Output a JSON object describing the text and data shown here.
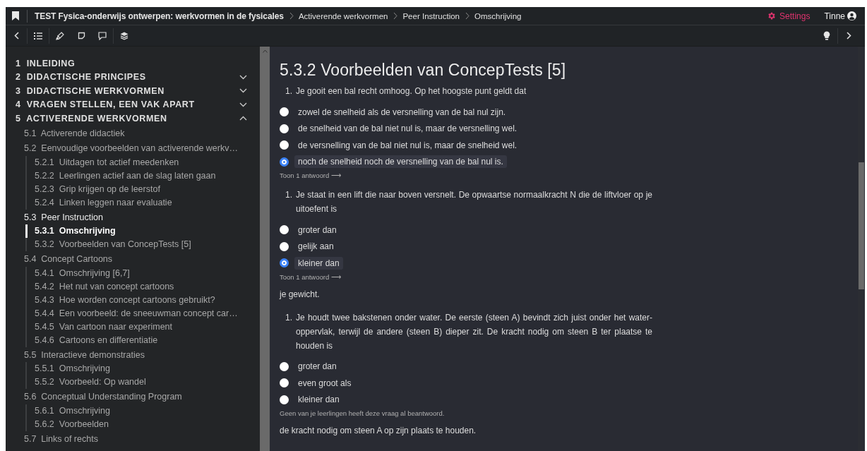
{
  "header": {
    "book_title": "TEST Fysica-onderwijs ontwerpen: werkvormen in de fysicales",
    "breadcrumbs": [
      "Activerende werkvormen",
      "Peer Instruction",
      "Omschrijving"
    ],
    "settings": "Settings",
    "user": "Tinne"
  },
  "sidebar": {
    "chapters": [
      {
        "number": "1",
        "title": "INLEIDING",
        "kind": "leaf"
      },
      {
        "number": "2",
        "title": "DIDACTISCHE PRINCIPES",
        "kind": "folder",
        "expanded": false
      },
      {
        "number": "3",
        "title": "DIDACTISCHE WERKVORMEN",
        "kind": "folder",
        "expanded": false
      },
      {
        "number": "4",
        "title": "VRAGEN STELLEN, EEN VAK APART",
        "kind": "folder",
        "expanded": false
      },
      {
        "number": "5",
        "title": "ACTIVERENDE WERKVORMEN",
        "kind": "folder",
        "expanded": true,
        "sections": [
          {
            "number": "5.1",
            "title": "Activerende didactiek",
            "active": false
          },
          {
            "number": "5.2",
            "title": "Eenvoudige voorbeelden van activerende werkv…",
            "active": false,
            "children": [
              {
                "number": "5.2.1",
                "title": "Uitdagen tot actief meedenken",
                "selected": false
              },
              {
                "number": "5.2.2",
                "title": "Leerlingen actief aan de slag laten gaan",
                "selected": false
              },
              {
                "number": "5.2.3",
                "title": "Grip krijgen op de leerstof",
                "selected": false
              },
              {
                "number": "5.2.4",
                "title": "Linken leggen naar evaluatie",
                "selected": false
              }
            ]
          },
          {
            "number": "5.3",
            "title": "Peer Instruction",
            "active": true,
            "children": [
              {
                "number": "5.3.1",
                "title": "Omschrijving",
                "selected": true
              },
              {
                "number": "5.3.2",
                "title": "Voorbeelden van ConcepTests [5]",
                "selected": false
              }
            ]
          },
          {
            "number": "5.4",
            "title": "Concept Cartoons",
            "active": false,
            "children": [
              {
                "number": "5.4.1",
                "title": "Omschrijving [6,7]",
                "selected": false
              },
              {
                "number": "5.4.2",
                "title": "Het nut van concept cartoons",
                "selected": false
              },
              {
                "number": "5.4.3",
                "title": "Hoe worden concept cartoons gebruikt?",
                "selected": false
              },
              {
                "number": "5.4.4",
                "title": "Een voorbeeld: de sneeuwman concept car…",
                "selected": false
              },
              {
                "number": "5.4.5",
                "title": "Van cartoon naar experiment",
                "selected": false
              },
              {
                "number": "5.4.6",
                "title": "Cartoons en differentiatie",
                "selected": false
              }
            ]
          },
          {
            "number": "5.5",
            "title": "Interactieve demonstraties",
            "active": false,
            "children": [
              {
                "number": "5.5.1",
                "title": "Omschrijving",
                "selected": false
              },
              {
                "number": "5.5.2",
                "title": "Voorbeeld: Op wandel",
                "selected": false
              }
            ]
          },
          {
            "number": "5.6",
            "title": "Conceptual Understanding Program",
            "active": false,
            "children": [
              {
                "number": "5.6.1",
                "title": "Omschrijving",
                "selected": false
              },
              {
                "number": "5.6.2",
                "title": "Voorbeelden",
                "selected": false
              }
            ]
          },
          {
            "number": "5.7",
            "title": "Links of rechts",
            "active": false
          }
        ]
      }
    ]
  },
  "content": {
    "title": "5.3.2 Voorbeelden van ConcepTests [5]",
    "blocks": [
      {
        "kind": "question",
        "number": "1.",
        "text": "Je gooit een bal recht omhoog. Op het hoogste punt geldt dat"
      },
      {
        "kind": "options",
        "options": [
          {
            "text": "zowel de snelheid als de versnelling van de bal nul zijn.",
            "selected": false
          },
          {
            "text": "de snelheid van de bal niet nul is, maar de versnelling wel.",
            "selected": false
          },
          {
            "text": "de versnelling van de bal niet nul is, maar de snelheid wel.",
            "selected": false
          },
          {
            "text": "noch de snelheid noch de versnelling van de bal nul is.",
            "selected": true
          }
        ]
      },
      {
        "kind": "link",
        "text": "Toon 1 antwoord ⟶"
      },
      {
        "kind": "question",
        "number": "1.",
        "text": "Je staat in een lift die naar boven versnelt. De opwaartse normaalkracht N die de liftvloer op je uitoefent is"
      },
      {
        "kind": "options",
        "options": [
          {
            "text": "groter dan",
            "selected": false
          },
          {
            "text": "gelijk aan",
            "selected": false
          },
          {
            "text": "kleiner dan",
            "selected": true
          }
        ]
      },
      {
        "kind": "link",
        "text": "Toon 1 antwoord ⟶"
      },
      {
        "kind": "paragraph",
        "text": "je gewicht."
      },
      {
        "kind": "question",
        "number": "1.",
        "text": "Je houdt twee bakstenen onder water. De eerste (steen A) bevindt zich juist onder het water-oppervlak, terwijl de andere (steen B) dieper zit. De kracht nodig om steen B ter plaatse te houden is"
      },
      {
        "kind": "options",
        "options": [
          {
            "text": "groter dan",
            "selected": false
          },
          {
            "text": "even groot als",
            "selected": false
          },
          {
            "text": "kleiner dan",
            "selected": false
          }
        ]
      },
      {
        "kind": "note",
        "text": "Geen van je leerlingen heeft deze vraag al beantwoord."
      },
      {
        "kind": "paragraph",
        "text": "de kracht nodig om steen A op zijn plaats te houden."
      }
    ]
  }
}
